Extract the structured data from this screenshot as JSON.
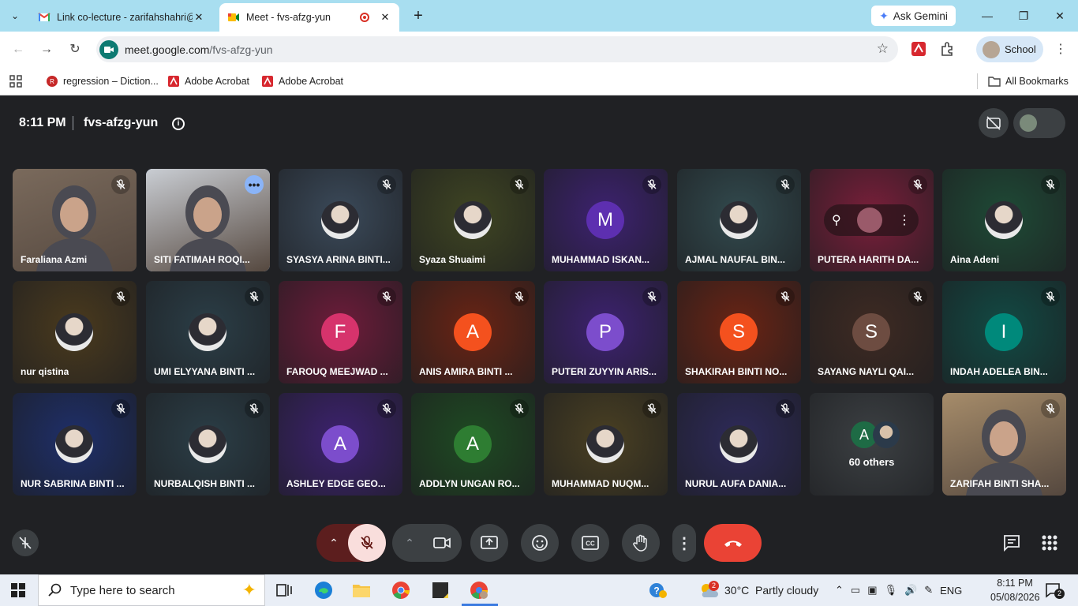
{
  "browser": {
    "tabs": [
      {
        "title": "Link co-lecture - zarifahshahri@",
        "close": "✕"
      },
      {
        "title": "Meet - fvs-afzg-yun",
        "close": "✕"
      }
    ],
    "new_tab": "+",
    "gemini_label": "Ask Gemini",
    "url_host": "meet.google.com",
    "url_path": "/fvs-afzg-yun",
    "profile_label": "School",
    "bookmarks": [
      {
        "label": "regression – Diction..."
      },
      {
        "label": "Adobe Acrobat"
      },
      {
        "label": "Adobe Acrobat"
      }
    ],
    "all_bookmarks": "All Bookmarks"
  },
  "meet": {
    "time": "8:11 PM",
    "code": "fvs-afzg-yun",
    "tiles": [
      {
        "name": "Faraliana Azmi",
        "kind": "video",
        "bg": "#7a6a5c"
      },
      {
        "name": "SITI FATIMAH ROQI...",
        "kind": "video",
        "bg": "#c9cdd3"
      },
      {
        "name": "SYASYA ARINA BINTI...",
        "kind": "photo",
        "bg": "#3b4a5a"
      },
      {
        "name": "Syaza Shuaimi",
        "kind": "photo",
        "bg": "#3f4522"
      },
      {
        "name": "MUHAMMAD ISKAN...",
        "kind": "letter",
        "letter": "M",
        "bg": "#3d2270",
        "circle": "#5d2fb0"
      },
      {
        "name": "AJMAL NAUFAL BIN...",
        "kind": "photo",
        "bg": "#324a4e"
      },
      {
        "name": "PUTERA HARITH DA...",
        "kind": "hover",
        "bg": "#7a1f3a"
      },
      {
        "name": "Aina Adeni",
        "kind": "photo",
        "bg": "#1f4a36"
      },
      {
        "name": "nur qistina",
        "kind": "photo",
        "bg": "#4a3a1e"
      },
      {
        "name": "UMI ELYYANA BINTI ...",
        "kind": "photo",
        "bg": "#2b3e47"
      },
      {
        "name": "FAROUQ MEEJWAD ...",
        "kind": "letter",
        "letter": "F",
        "bg": "#6e1c3a",
        "circle": "#d6336c"
      },
      {
        "name": "ANIS AMIRA BINTI ...",
        "kind": "letter",
        "letter": "A",
        "bg": "#6a2414",
        "circle": "#f4511e"
      },
      {
        "name": "PUTERI ZUYYIN ARIS...",
        "kind": "letter",
        "letter": "P",
        "bg": "#3d2270",
        "circle": "#7c4dcc"
      },
      {
        "name": "SHAKIRAH BINTI NO...",
        "kind": "letter",
        "letter": "S",
        "bg": "#6a2414",
        "circle": "#f4511e"
      },
      {
        "name": "SAYANG NAYLI QAI...",
        "kind": "letter",
        "letter": "S",
        "bg": "#3e2a22",
        "circle": "#6d4c41"
      },
      {
        "name": "INDAH ADELEA BIN...",
        "kind": "letter",
        "letter": "I",
        "bg": "#124a44",
        "circle": "#00897b"
      },
      {
        "name": "NUR SABRINA BINTI ...",
        "kind": "photo",
        "bg": "#1e2f6a"
      },
      {
        "name": "NURBALQISH BINTI ...",
        "kind": "photo",
        "bg": "#2b3e47"
      },
      {
        "name": "ASHLEY EDGE GEO...",
        "kind": "letter",
        "letter": "A",
        "bg": "#3d2270",
        "circle": "#7c4dcc"
      },
      {
        "name": "ADDLYN UNGAN RO...",
        "kind": "letter",
        "letter": "A",
        "bg": "#1f4a22",
        "circle": "#2e7d32"
      },
      {
        "name": "MUHAMMAD NUQM...",
        "kind": "photo",
        "bg": "#4a4022"
      },
      {
        "name": "NURUL AUFA DANIA...",
        "kind": "photo",
        "bg": "#2e2a5a"
      },
      {
        "name": "60 others",
        "kind": "others",
        "letter": "A",
        "bg": "#3c4043"
      },
      {
        "name": "ZARIFAH BINTI SHA...",
        "kind": "video",
        "bg": "#a68c6a"
      }
    ]
  },
  "taskbar": {
    "search_placeholder": "Type here to search",
    "notification_count": "2",
    "weather": "30°C  Partly cloudy",
    "lang": "ENG",
    "clock_time": "8:11 PM",
    "clock_date": "05/08/2026",
    "action_count": "2"
  },
  "colors": {
    "tabbar": "#a8def0",
    "meet_bg": "#202124",
    "end_call": "#ea4335",
    "mic_off": "#f9dedc"
  }
}
